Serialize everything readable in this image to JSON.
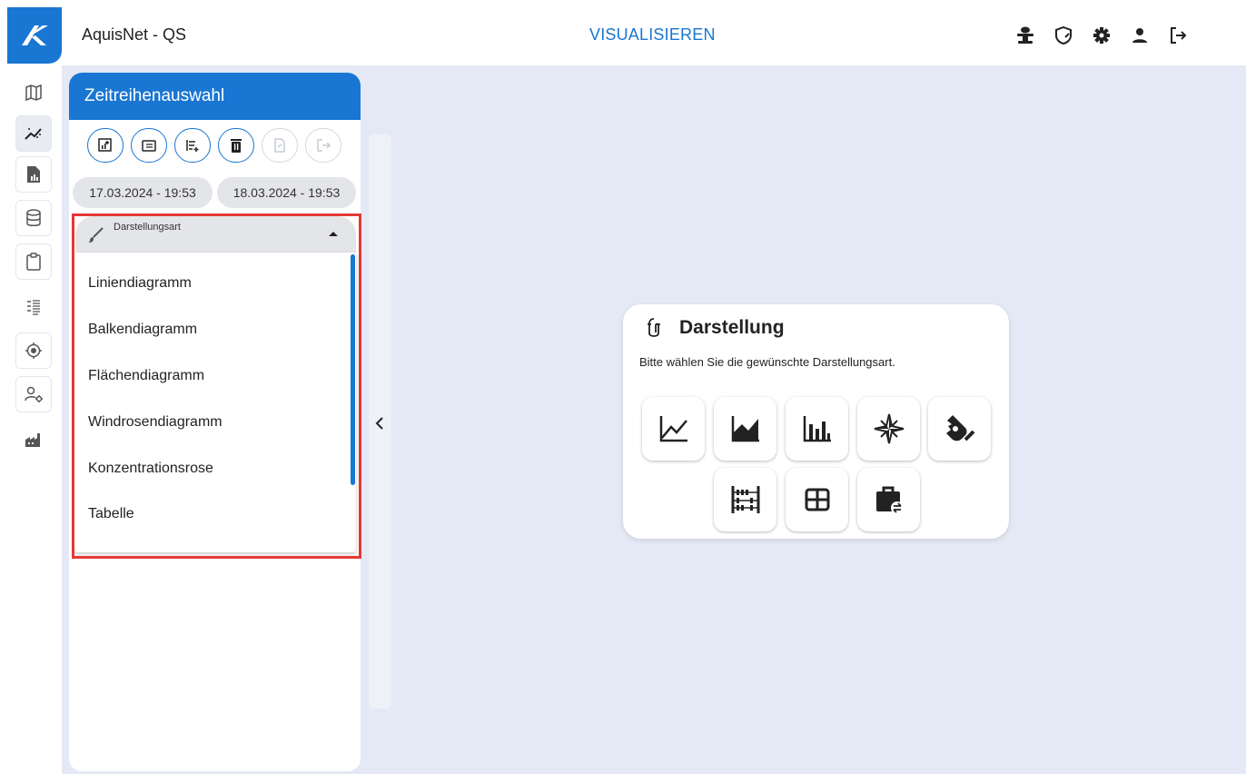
{
  "header": {
    "app_title": "AquisNet - QS",
    "page_title": "VISUALISIEREN",
    "icons": [
      "station-icon",
      "shield-icon",
      "gear-icon",
      "user-icon",
      "logout-icon"
    ]
  },
  "rail": {
    "items": [
      "map-icon",
      "visualize-icon",
      "report-icon",
      "database-icon",
      "clipboard-icon",
      "checklist-icon",
      "target-icon",
      "user-settings-icon",
      "factory-icon"
    ],
    "active": "visualize-icon"
  },
  "panel": {
    "title": "Zeitreihenauswahl",
    "toolbar": [
      "add-chart-icon",
      "folder-list-icon",
      "list-add-icon",
      "delete-icon",
      "export-file-icon",
      "logout-export-icon"
    ],
    "date_from": "17.03.2024 - 19:53",
    "date_to": "18.03.2024 - 19:53",
    "select": {
      "label": "Darstellungsart",
      "options": [
        "Liniendiagramm",
        "Balkendiagramm",
        "Flächendiagramm",
        "Windrosendiagramm",
        "Konzentrationsrose",
        "Tabelle"
      ]
    }
  },
  "card": {
    "title": "Darstellung",
    "subtitle": "Bitte wählen Sie die gewünschte Darstellungsart.",
    "buttons": [
      "line-chart-icon",
      "area-chart-icon",
      "bar-chart-icon",
      "compass-rose-icon",
      "gesture-icon",
      "abacus-icon",
      "table-icon",
      "briefcase-switch-icon"
    ]
  },
  "colors": {
    "primary": "#1976d2",
    "highlight": "#e53935",
    "background": "#e4e9f5"
  }
}
